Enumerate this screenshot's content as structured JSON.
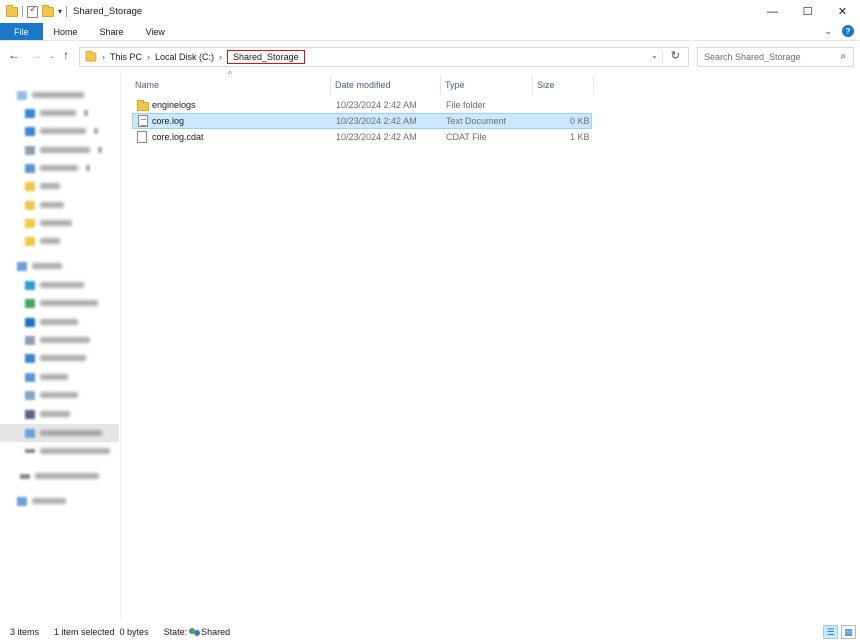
{
  "window": {
    "title": "Shared_Storage"
  },
  "ribbon": {
    "tabs": [
      "File",
      "Home",
      "Share",
      "View"
    ]
  },
  "address": {
    "crumbs": [
      "This PC",
      "Local Disk (C:)",
      "Shared_Storage"
    ]
  },
  "search": {
    "placeholder": "Search Shared_Storage"
  },
  "columns": {
    "name": "Name",
    "date": "Date modified",
    "type": "Type",
    "size": "Size"
  },
  "files": [
    {
      "name": "enginelogs",
      "date": "10/23/2024 2:42 AM",
      "type": "File folder",
      "size": "",
      "icon": "folder-icon"
    },
    {
      "name": "core.log",
      "date": "10/23/2024 2:42 AM",
      "type": "Text Document",
      "size": "0 KB",
      "icon": "text-file-icon"
    },
    {
      "name": "core.log.cdat",
      "date": "10/23/2024 2:42 AM",
      "type": "CDAT File",
      "size": "1 KB",
      "icon": "file-icon"
    }
  ],
  "status": {
    "items": "3 items",
    "selected": "1 item selected",
    "size": "0 bytes",
    "state_label": "State:",
    "state_value": "Shared"
  },
  "colors": {
    "accent": "#1979ca",
    "selection": "#cce8ff",
    "highlight_box": "#dd1111"
  }
}
